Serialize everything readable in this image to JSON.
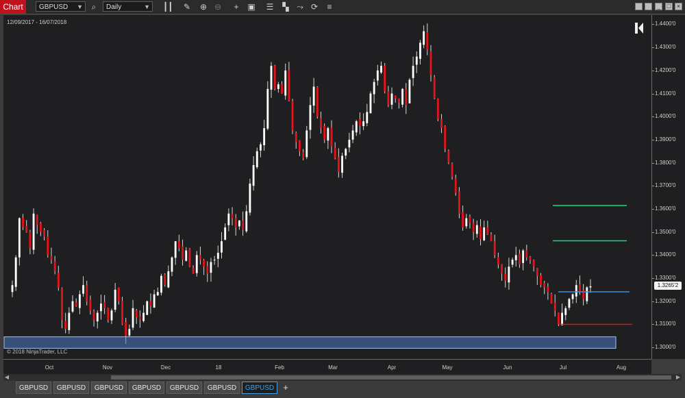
{
  "toolbar": {
    "chart_label": "Chart",
    "instrument": "GBPUSD",
    "interval": "Daily",
    "icons": [
      "search-icon",
      "bars-type-icon",
      "draw-pencil-icon",
      "zoom-in-icon",
      "zoom-out-icon",
      "crosshair-icon",
      "data-box-icon",
      "ladder-icon",
      "tile-icon",
      "strategies-icon",
      "reload-icon",
      "properties-icon"
    ]
  },
  "window_buttons": [
    "tile-window-icon",
    "stack-window-icon",
    "minimize-icon",
    "maximize-icon",
    "close-icon"
  ],
  "date_range": "12/09/2017 - 16/07/2018",
  "copyright": "© 2018 NinjaTrader, LLC",
  "last_price": "1.3265'2",
  "colors": {
    "up": "#ffffff",
    "down": "#e3151a",
    "background": "#1f1f21",
    "support_zone": "#4a78c4",
    "target_line": "#00e676",
    "entry_line": "#3d8fe0",
    "stop_line": "#e3151a"
  },
  "chart_data": {
    "type": "candlestick",
    "instrument": "GBPUSD",
    "interval": "Daily",
    "ylim": [
      1.295,
      1.444
    ],
    "yticks": [
      "1.4400'0",
      "1.4300'0",
      "1.4200'0",
      "1.4100'0",
      "1.4000'0",
      "1.3900'0",
      "1.3800'0",
      "1.3700'0",
      "1.3600'0",
      "1.3500'0",
      "1.3400'0",
      "1.3300'0",
      "1.3200'0",
      "1.3100'0",
      "1.3000'0"
    ],
    "xticks": [
      "Oct",
      "Nov",
      "Dec",
      "18",
      "Feb",
      "Mar",
      "Apr",
      "May",
      "Jun",
      "Jul",
      "Aug"
    ],
    "close_series": [
      1.327,
      1.339,
      1.356,
      1.352,
      1.35,
      1.343,
      1.358,
      1.353,
      1.35,
      1.348,
      1.34,
      1.338,
      1.333,
      1.326,
      1.312,
      1.308,
      1.315,
      1.32,
      1.318,
      1.323,
      1.327,
      1.32,
      1.316,
      1.312,
      1.315,
      1.319,
      1.317,
      1.312,
      1.316,
      1.325,
      1.32,
      1.31,
      1.305,
      1.308,
      1.317,
      1.313,
      1.312,
      1.315,
      1.32,
      1.318,
      1.323,
      1.324,
      1.331,
      1.327,
      1.333,
      1.339,
      1.346,
      1.343,
      1.338,
      1.342,
      1.335,
      1.332,
      1.34,
      1.338,
      1.335,
      1.332,
      1.337,
      1.338,
      1.341,
      1.346,
      1.352,
      1.358,
      1.356,
      1.352,
      1.355,
      1.351,
      1.359,
      1.371,
      1.379,
      1.385,
      1.388,
      1.395,
      1.412,
      1.422,
      1.412,
      1.414,
      1.41,
      1.42,
      1.407,
      1.394,
      1.389,
      1.385,
      1.382,
      1.394,
      1.405,
      1.413,
      1.4,
      1.395,
      1.39,
      1.395,
      1.387,
      1.382,
      1.376,
      1.383,
      1.386,
      1.39,
      1.394,
      1.398,
      1.396,
      1.398,
      1.402,
      1.41,
      1.415,
      1.42,
      1.422,
      1.411,
      1.405,
      1.41,
      1.408,
      1.406,
      1.412,
      1.405,
      1.416,
      1.422,
      1.426,
      1.432,
      1.437,
      1.429,
      1.418,
      1.408,
      1.399,
      1.395,
      1.386,
      1.38,
      1.374,
      1.367,
      1.358,
      1.352,
      1.356,
      1.354,
      1.35,
      1.353,
      1.347,
      1.352,
      1.349,
      1.346,
      1.34,
      1.336,
      1.332,
      1.329,
      1.335,
      1.338,
      1.34,
      1.336,
      1.342,
      1.339,
      1.338,
      1.335,
      1.331,
      1.327,
      1.326,
      1.324,
      1.319,
      1.316,
      1.31,
      1.315,
      1.317,
      1.321,
      1.323,
      1.327,
      1.324,
      1.321,
      1.326,
      1.3265
    ]
  },
  "annotations": {
    "support_zone": {
      "low": 1.302,
      "high": 1.304
    },
    "target_2": 1.3615,
    "target_1": 1.3462,
    "entry": 1.3241,
    "stop": 1.31
  },
  "tabs": [
    "GBPUSD",
    "GBPUSD",
    "GBPUSD",
    "GBPUSD",
    "GBPUSD",
    "GBPUSD",
    "GBPUSD"
  ],
  "active_tab_index": 6
}
